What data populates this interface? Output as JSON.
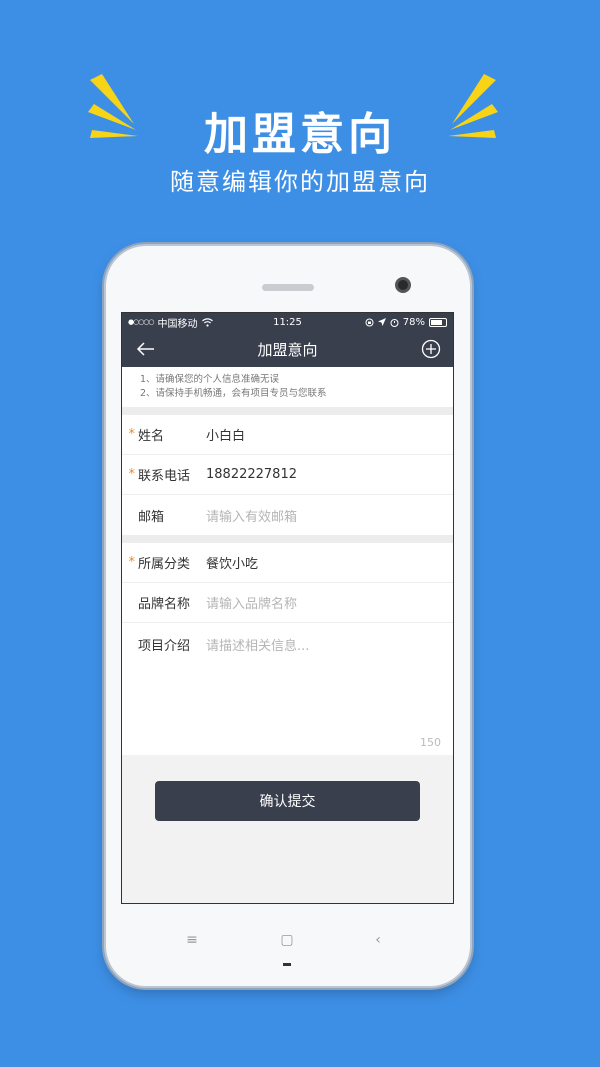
{
  "promo": {
    "title": "加盟意向",
    "subtitle": "随意编辑你的加盟意向",
    "accent_color": "#f7d417",
    "background_color": "#3d8fe6"
  },
  "statusbar": {
    "signal": "●○○○○",
    "carrier": "中国移动",
    "wifi_icon": "wifi-icon",
    "time": "11:25",
    "battery": "78%",
    "battery_level": 0.78
  },
  "navbar": {
    "title": "加盟意向",
    "back_icon": "arrow-left-icon",
    "add_icon": "plus-circle-icon"
  },
  "notice": {
    "line1": "1、请确保您的个人信息准确无误",
    "line2": "2、请保持手机畅通，会有项目专员与您联系"
  },
  "form": {
    "name": {
      "label": "姓名",
      "value": "小白白",
      "required": "*"
    },
    "phone": {
      "label": "联系电话",
      "value": "18822227812",
      "required": "*"
    },
    "email": {
      "label": "邮箱",
      "placeholder": "请输入有效邮箱"
    },
    "category": {
      "label": "所属分类",
      "value": "餐饮小吃",
      "required": "*"
    },
    "brand": {
      "label": "品牌名称",
      "placeholder": "请输入品牌名称"
    },
    "intro": {
      "label": "项目介绍",
      "placeholder": "请描述相关信息...",
      "char_limit": "150"
    }
  },
  "submit": {
    "label": "确认提交"
  },
  "device_keys": {
    "menu": "≡",
    "home": "▢",
    "back": "‹"
  }
}
